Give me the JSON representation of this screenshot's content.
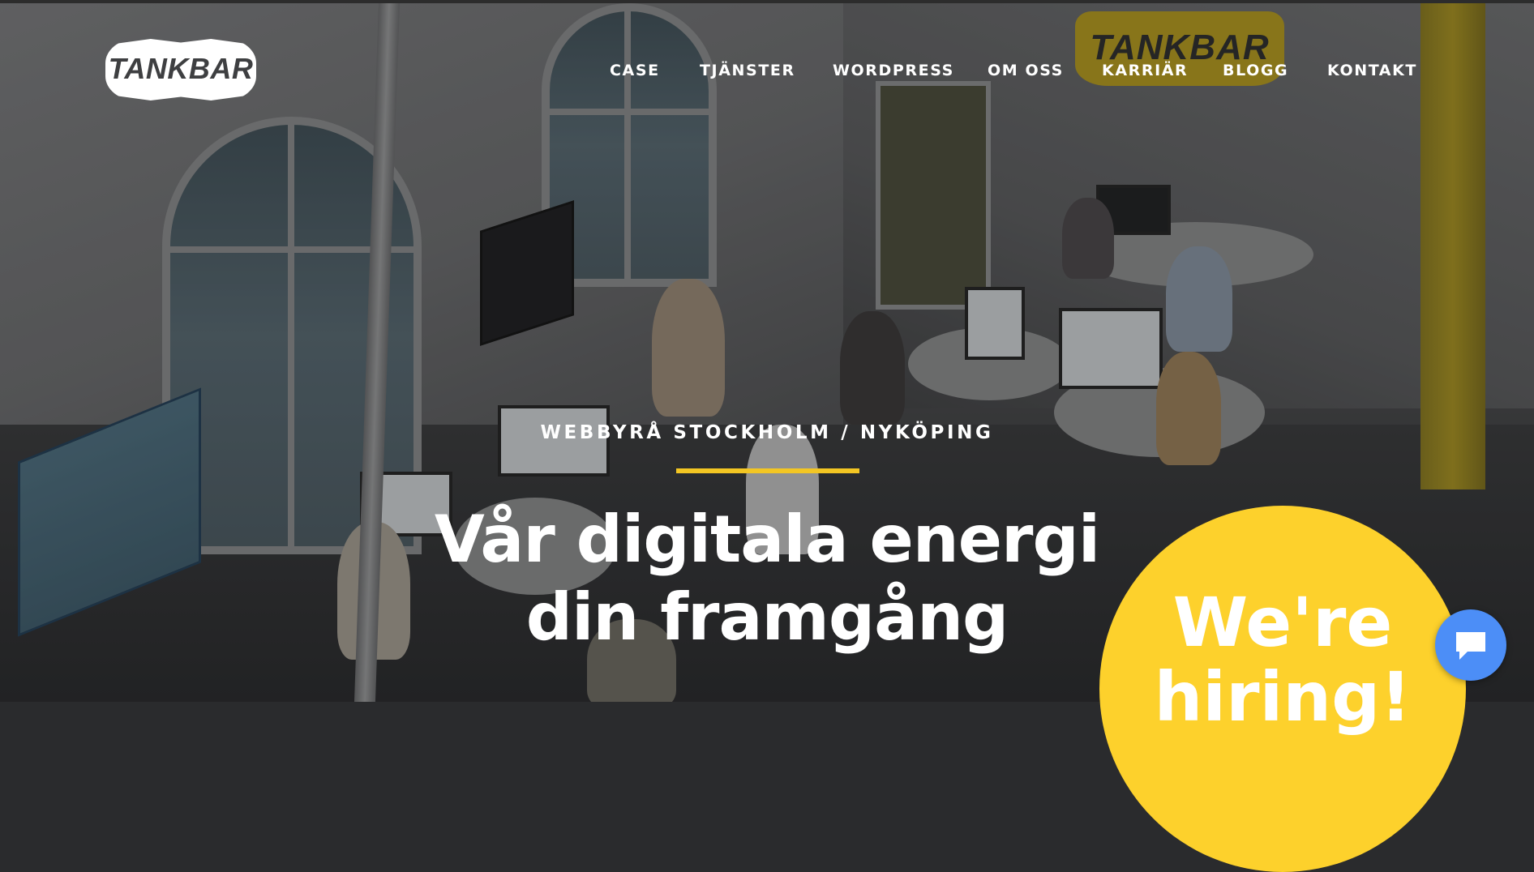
{
  "header": {
    "logo_text": "TANKBAR",
    "nav": [
      {
        "label": "CASE"
      },
      {
        "label": "TJÄNSTER"
      },
      {
        "label": "WORDPRESS"
      },
      {
        "label": "OM OSS"
      },
      {
        "label": "KARRIÄR"
      },
      {
        "label": "BLOGG"
      },
      {
        "label": "KONTAKT"
      }
    ]
  },
  "hero": {
    "eyebrow": "WEBBYRÅ STOCKHOLM / NYKÖPING",
    "headline_line1": "Vår digitala energi",
    "headline_line2": "din framgång",
    "wall_sign_text": "TANKBAR"
  },
  "hiring_badge": {
    "line1": "We're",
    "line2": "hiring!"
  },
  "chat_widget": {
    "icon": "chat-bubble-icon"
  },
  "colors": {
    "accent_yellow": "#fdd12c",
    "underline_yellow": "#f3c623",
    "chat_blue": "#4c8ef7",
    "text_white": "#ffffff"
  }
}
